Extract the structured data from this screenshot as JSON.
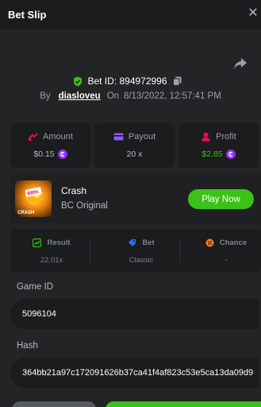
{
  "header": {
    "title": "Bet Slip"
  },
  "bet": {
    "id_label": "Bet ID: 894972996",
    "by_label": "By",
    "username": "diasloveu",
    "on_label": "On",
    "datetime": "8/13/2022, 12:57:41 PM"
  },
  "stats": [
    {
      "label": "Amount",
      "value": "$0.15",
      "icon": "coins-icon",
      "coin": true,
      "color": "#b5b9bd"
    },
    {
      "label": "Payout",
      "value": "20 x",
      "icon": "wallet-icon",
      "coin": false,
      "color": "#b5b9bd"
    },
    {
      "label": "Profit",
      "value": "$2.85",
      "icon": "profit-icon",
      "coin": true,
      "color": "#3bc117"
    }
  ],
  "game": {
    "name": "Crash",
    "provider": "BC Original",
    "play_label": "Play Now",
    "thumb_multiplier": "999x",
    "thumb_label": "CRASH"
  },
  "result": [
    {
      "label": "Result",
      "value": "22.01x",
      "icon": "result-icon"
    },
    {
      "label": "Bet",
      "value": "Classic",
      "icon": "bet-icon"
    },
    {
      "label": "Chance",
      "value": "-",
      "icon": "chance-icon"
    }
  ],
  "fields": {
    "game_id_label": "Game ID",
    "game_id_value": "5096104",
    "hash_label": "Hash",
    "hash_value": "364bb21a97c172091626b37ca41f4af823c53e5ca13da09d9"
  },
  "colors": {
    "accent_green": "#3bc117",
    "coin_purple": "#8b2cf5",
    "panel": "#222426",
    "card": "#1a1c1e"
  }
}
